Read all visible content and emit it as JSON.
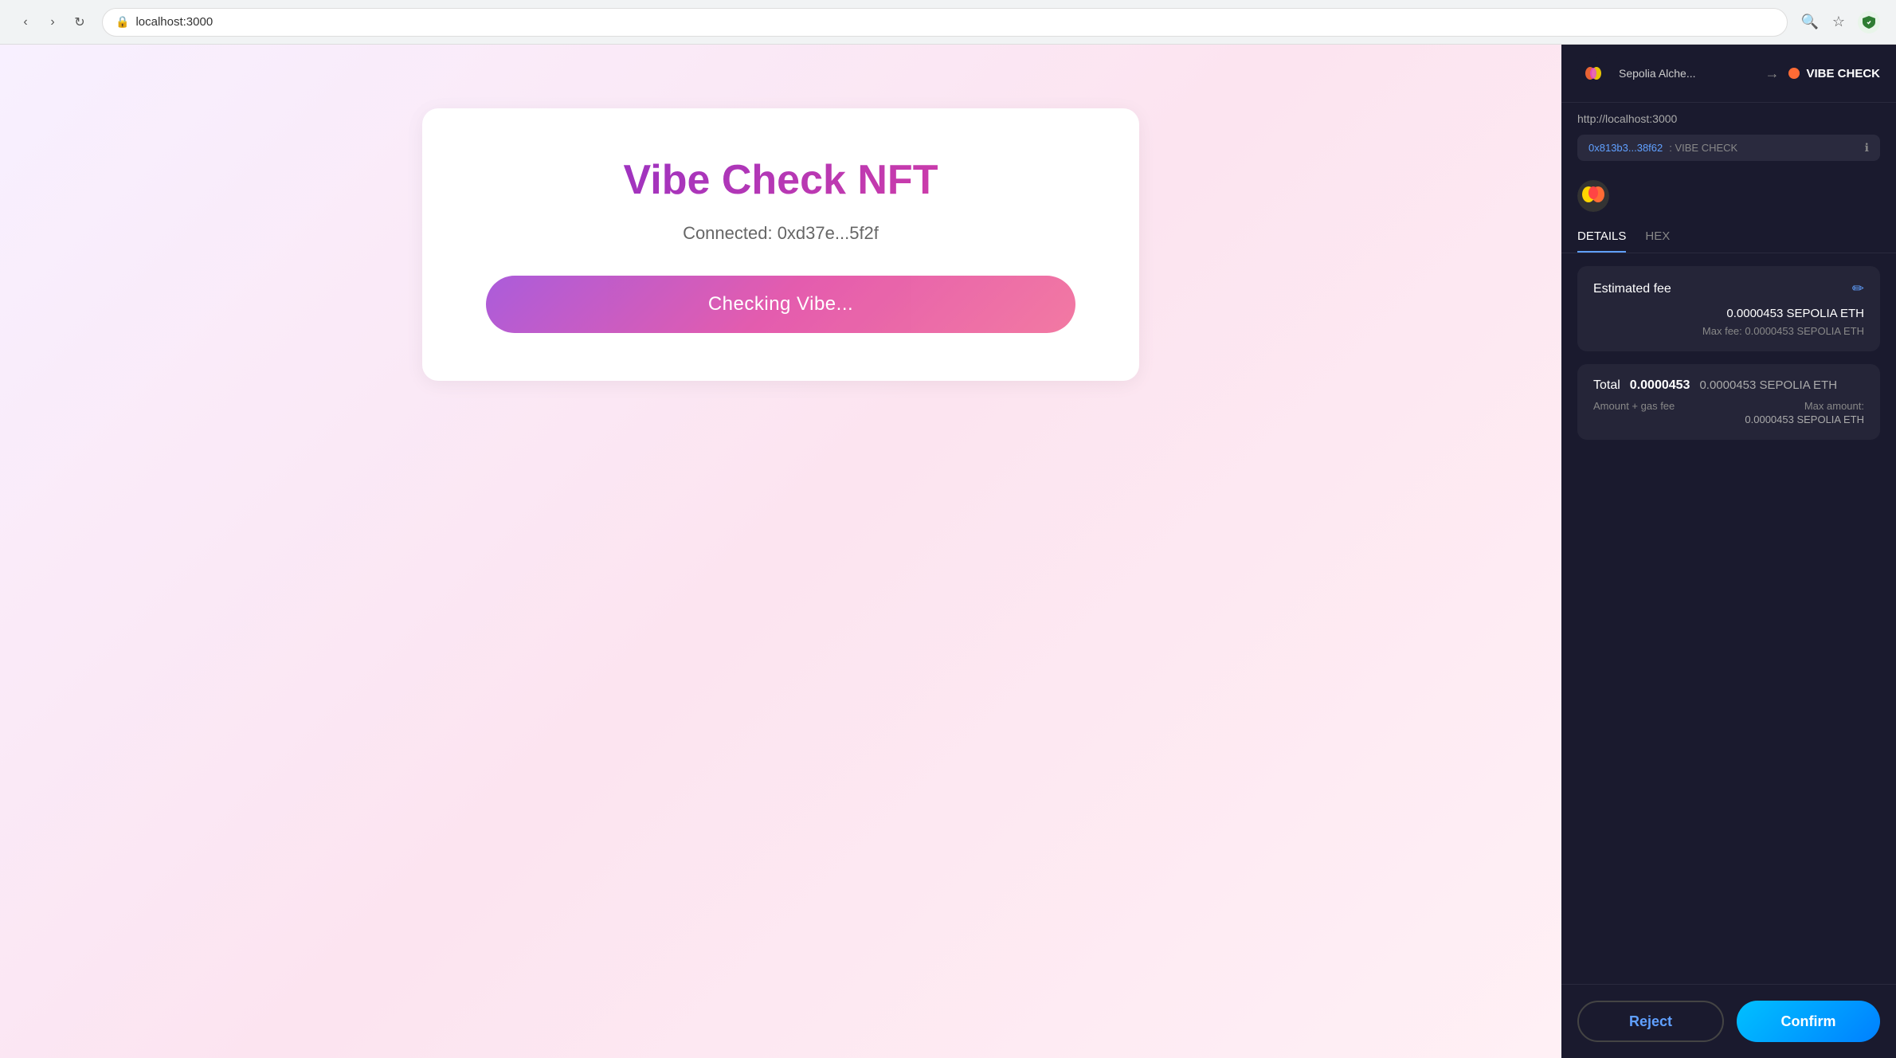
{
  "browser": {
    "url": "localhost:3000",
    "reload_icon": "↻",
    "search_icon": "⌕",
    "star_icon": "☆",
    "shield_color": "#2e7d32"
  },
  "webapp": {
    "title": "Vibe Check NFT",
    "connected_label": "Connected: 0xd37e...5f2f",
    "button_label": "Checking Vibe..."
  },
  "metamask": {
    "network_name": "Sepolia Alche...",
    "dapp_name": "VIBE CHECK",
    "url": "http://localhost:3000",
    "account_address": "0x813b3...38f62",
    "account_label": ": VIBE CHECK",
    "tabs": [
      {
        "label": "DETAILS",
        "active": true
      },
      {
        "label": "HEX",
        "active": false
      }
    ],
    "estimated_fee": {
      "title": "Estimated fee",
      "amount": "0.0000453 SEPOLIA ETH",
      "max_label": "Max fee:",
      "max_amount": "0.0000453 SEPOLIA ETH"
    },
    "total": {
      "label": "Total",
      "bold_amount": "0.0000453",
      "eth_amount": "0.0000453 SEPOLIA ETH",
      "sub_label": "Amount + gas fee",
      "max_label": "Max amount:",
      "max_value": "0.0000453 SEPOLIA ETH"
    },
    "reject_button": "Reject",
    "confirm_button": "Confirm"
  }
}
